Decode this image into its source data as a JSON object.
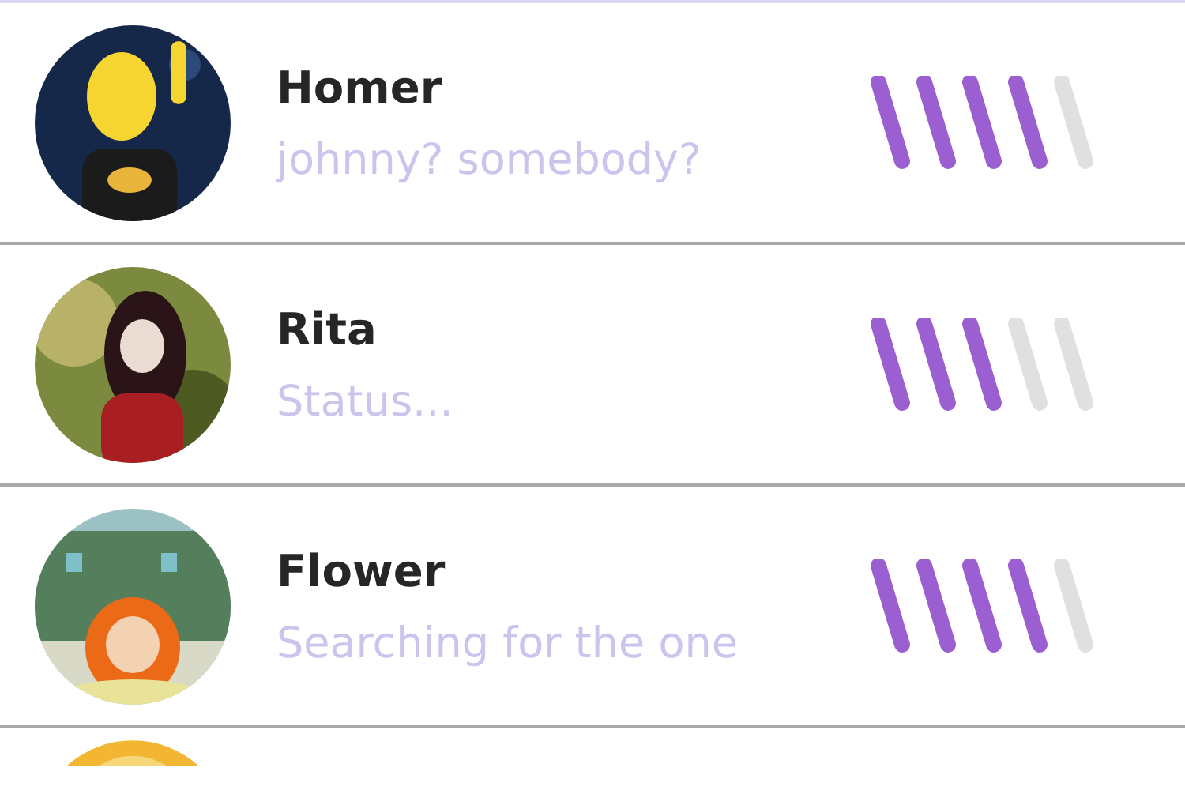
{
  "contacts": [
    {
      "name": "Homer",
      "status": "johnny? somebody?",
      "level": 0.8
    },
    {
      "name": "Rita",
      "status": "Status...",
      "level": 0.6
    },
    {
      "name": "Flower",
      "status": "Searching for the one",
      "level": 0.8
    }
  ]
}
